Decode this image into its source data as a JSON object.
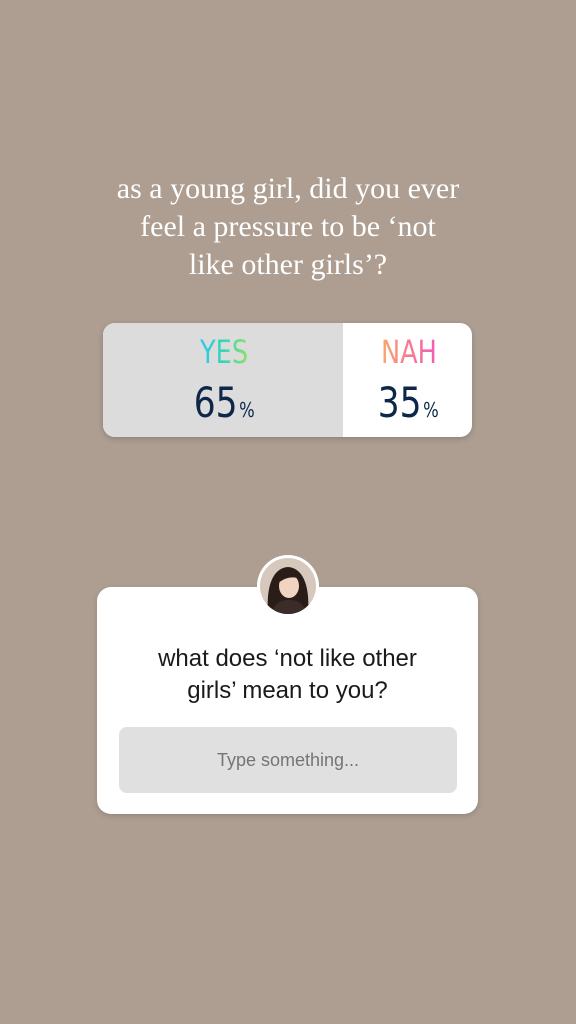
{
  "story": {
    "background_color": "#ad9e91",
    "question": "as a young girl, did you ever\nfeel a pressure to be ‘not\nlike other girls’?"
  },
  "poll": {
    "winner_fill_percent": 65,
    "options": [
      {
        "label": "YES",
        "percent": "65",
        "percent_sign": "%"
      },
      {
        "label": "NAH",
        "percent": "35",
        "percent_sign": "%"
      }
    ]
  },
  "question_box": {
    "avatar_icon": "profile-avatar",
    "prompt": "what does ‘not like other\ngirls’ mean to you?",
    "input_placeholder": "Type something..."
  }
}
